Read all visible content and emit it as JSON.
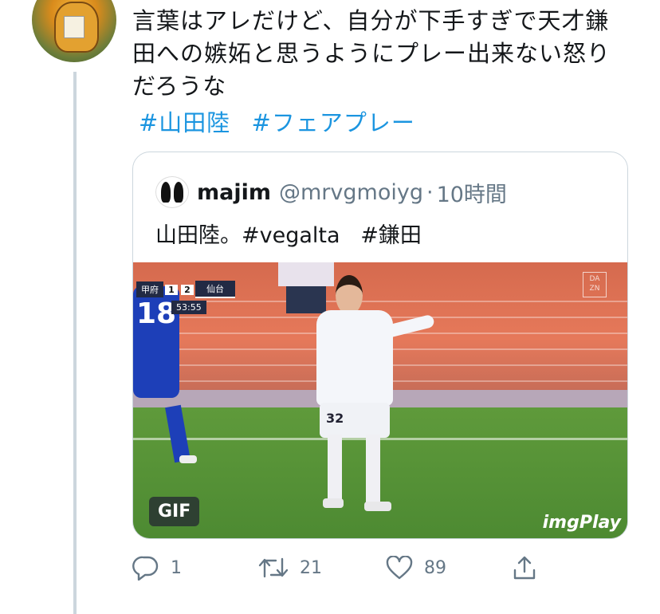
{
  "tweet": {
    "text": "言葉はアレだけど、自分が下手すぎで天才鎌田への嫉妬と思うようにプレー出来ない怒りだろうな",
    "hashtags": [
      "#山田陸",
      "#フェアプレー"
    ]
  },
  "quote": {
    "name": "majim",
    "handle": "@mrvgmoiyg",
    "separator": "·",
    "time": "10時間",
    "text_plain": "山田陸。",
    "tags": [
      "#vegalta",
      "#鎌田"
    ],
    "media": {
      "badge": "GIF",
      "watermark": "imgPlay",
      "scoreboard": {
        "home": "甲府",
        "home_score": "1",
        "away_score": "2",
        "away": "仙台",
        "clock": "53:55"
      },
      "broadcaster": "DA ZN",
      "blue_player_number": "18",
      "white_player_number": "32"
    }
  },
  "actions": {
    "reply_count": "1",
    "retweet_count": "21",
    "like_count": "89"
  },
  "icons": {
    "reply": "reply-icon",
    "retweet": "retweet-icon",
    "like": "heart-icon",
    "share": "share-icon"
  },
  "colors": {
    "link": "#1b95e0",
    "secondary_text": "#657786",
    "thread_line": "#ccd6dd"
  }
}
